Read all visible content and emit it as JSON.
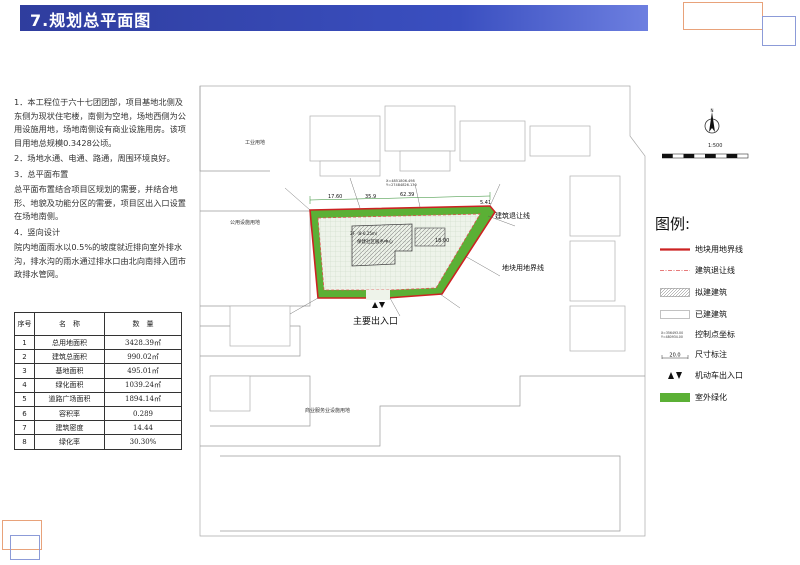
{
  "header": {
    "title": "7.规划总平面图"
  },
  "description": {
    "p1": "1．本工程位于六十七团团部，项目基地北侧及东侧为现状住宅楼，南侧为空地，场地西侧为公用设施用地，场地南侧设有商业设施用房。该项目用地总规模0.3428公顷。",
    "p2": "2．场地水通、电通、路通，周围环境良好。",
    "p3": "3．总平面布置",
    "p4": "总平面布置结合项目区规划的需要，并结合地形、地貌及功能分区的需要，项目区出入口设置在场地南侧。",
    "p5": "4．竖向设计",
    "p6": "院内地面雨水以0.5%的坡度就近排向室外排水沟，排水沟的雨水通过排水口由北向南排入团市政排水管网。"
  },
  "table": {
    "headers": {
      "no": "序号",
      "name": "名　称",
      "qty": "数　量"
    },
    "rows": [
      {
        "no": "1",
        "name": "总用地面积",
        "qty": "3428.39㎡"
      },
      {
        "no": "2",
        "name": "建筑总面积",
        "qty": "990.02㎡"
      },
      {
        "no": "3",
        "name": "基地面积",
        "qty": "495.01㎡"
      },
      {
        "no": "4",
        "name": "绿化面积",
        "qty": "1039.24㎡"
      },
      {
        "no": "5",
        "name": "道路广场面积",
        "qty": "1894.14㎡"
      },
      {
        "no": "6",
        "name": "容积率",
        "qty": "0.289"
      },
      {
        "no": "7",
        "name": "建筑密度",
        "qty": "14.44"
      },
      {
        "no": "8",
        "name": "绿化率",
        "qty": "30.30%"
      }
    ]
  },
  "plan": {
    "labels": {
      "industrial": "工业用地",
      "public_facility": "公用设施用地",
      "commercial": "商业服务业设施用地",
      "building_name": "保建社区服务中心",
      "building_floor": "2F（8-6.25m）",
      "setback_line": "建筑退让线",
      "boundary_line": "地块用地界线",
      "main_entrance": "主要出入口",
      "dim_1": "17.60",
      "dim_2": "35.9",
      "dim_3": "62.39",
      "dim_4": "18.00",
      "dim_5": "5.41",
      "coord_1": "X=4851806.498",
      "coord_2": "Y=27484826.130"
    }
  },
  "legend": {
    "title": "图例:",
    "items": [
      {
        "label": "地块用地界线"
      },
      {
        "label": "建筑退让线"
      },
      {
        "label": "拟建建筑"
      },
      {
        "label": "已建建筑"
      },
      {
        "label": "控制点坐标"
      },
      {
        "label": "尺寸标注"
      },
      {
        "label": "机动车出入口"
      },
      {
        "label": "室外绿化"
      }
    ],
    "coord_sample": "X=356493.00",
    "coord_sample_y": "Y=480934.00",
    "dim_sample": "20.0"
  },
  "north": {
    "letter": "N",
    "scale": "1:500"
  },
  "colors": {
    "header": "#2f3d9e",
    "boundary": "#cc2222",
    "green": "#5bb035",
    "setback": "#e05050"
  }
}
